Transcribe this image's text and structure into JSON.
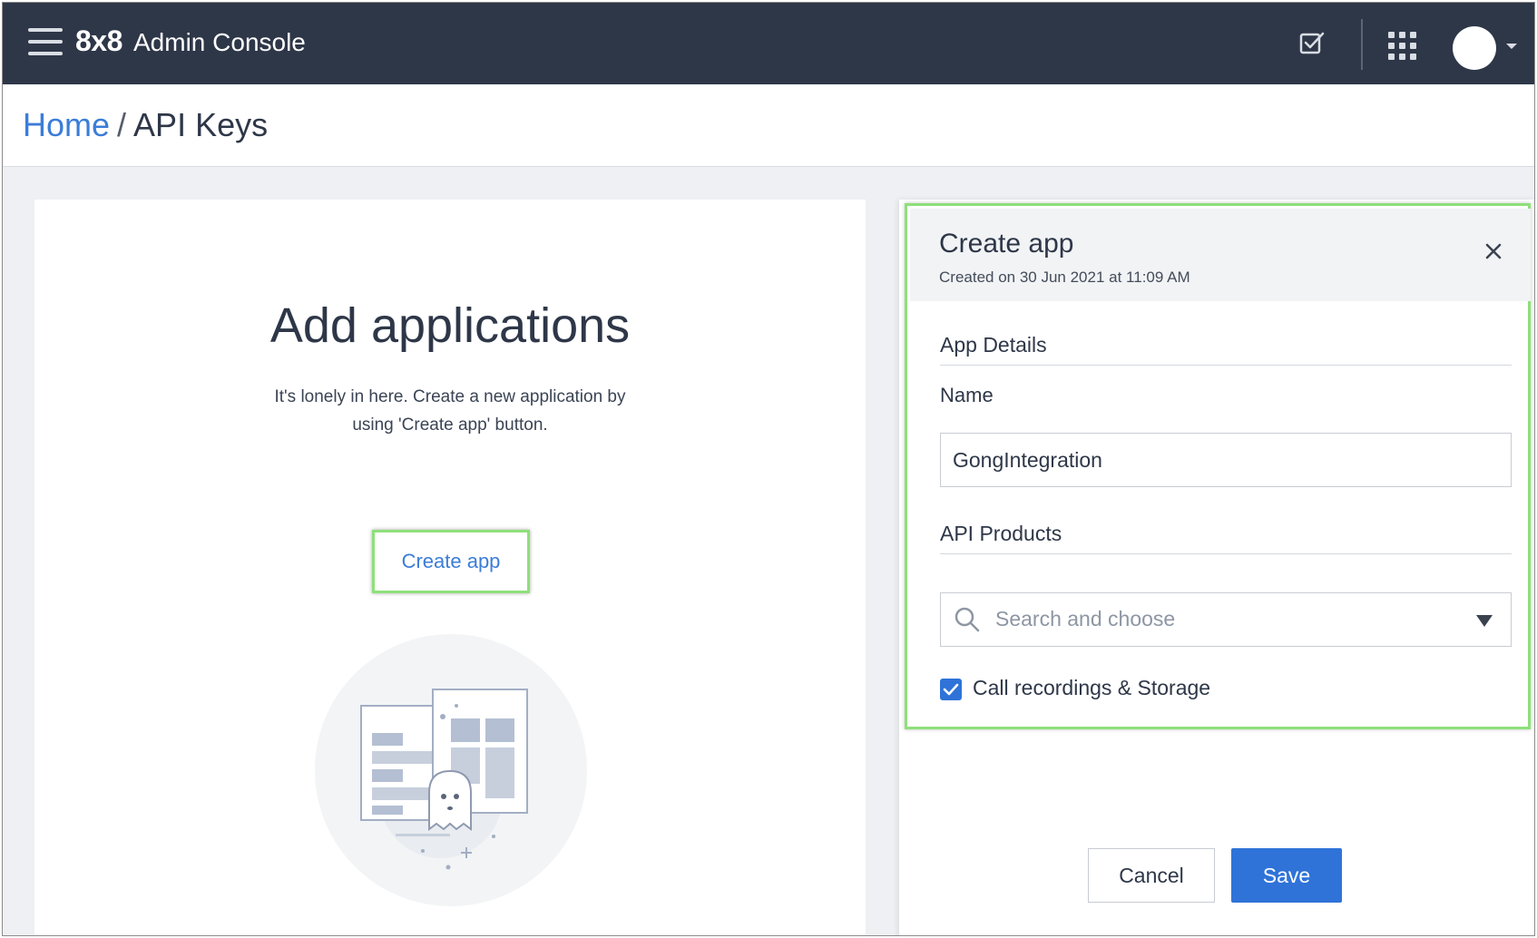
{
  "header": {
    "logo": "8x8",
    "title": "Admin Console"
  },
  "breadcrumb": {
    "home": "Home",
    "separator": "/",
    "current": "API Keys"
  },
  "empty_state": {
    "title": "Add applications",
    "description": "It's lonely in here. Create a new application by using 'Create app' button.",
    "create_button": "Create app"
  },
  "panel": {
    "title": "Create app",
    "subtitle": "Created on 30 Jun 2021 at 11:09 AM",
    "app_details_label": "App Details",
    "name_label": "Name",
    "name_value": "GongIntegration",
    "api_products_label": "API Products",
    "search_placeholder": "Search and choose",
    "checkbox_label": "Call recordings & Storage",
    "checkbox_checked": true,
    "cancel_label": "Cancel",
    "save_label": "Save"
  },
  "colors": {
    "topbar": "#2e3748",
    "accent": "#2f73d8",
    "link": "#3b7dd8",
    "highlight": "#8ee07a"
  }
}
